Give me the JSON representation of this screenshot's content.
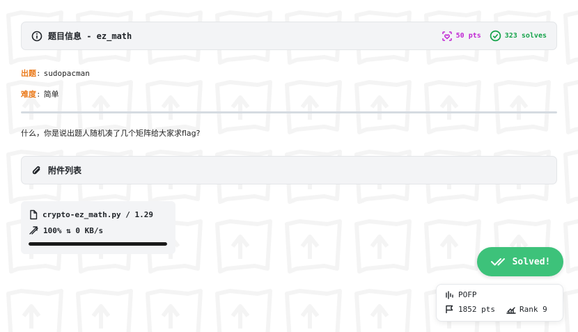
{
  "challenge": {
    "info_title": "题目信息 - ez_math",
    "points": "50 pts",
    "solves": "323 solves",
    "author_label": "出题",
    "author": "sudopacman",
    "difficulty_label": "难度",
    "difficulty": "简单",
    "description": "什么，你是说出题人随机凑了几个矩阵给大家求flag?",
    "colon": ":"
  },
  "attachments": {
    "title": "附件列表",
    "file": {
      "name": "crypto-ez_math.py / 1.29",
      "status": "100% ⇅ 0 KB/s",
      "progress": 1.0
    }
  },
  "solved": {
    "label": "Solved!"
  },
  "user": {
    "name": "POFP",
    "points": "1852 pts",
    "rank": "Rank 9"
  },
  "colors": {
    "accent_orange": "#ea7a1b",
    "points_magenta": "#c026d3",
    "solves_green": "#15a34a",
    "solved_button": "#3dc27a"
  }
}
